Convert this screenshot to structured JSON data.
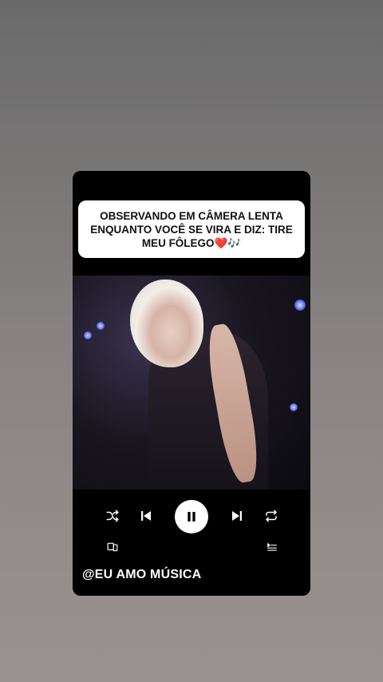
{
  "caption": {
    "text": "OBSERVANDO EM CÂMERA LENTA ENQUANTO VOCÊ SE VIRA E DIZ: TIRE MEU FÔLEGO❤️🎶"
  },
  "player": {
    "controls": {
      "shuffle_icon": "shuffle-icon",
      "previous_icon": "skip-previous-icon",
      "pause_icon": "pause-icon",
      "next_icon": "skip-next-icon",
      "repeat_icon": "repeat-icon"
    },
    "secondary": {
      "devices_icon": "devices-icon",
      "queue_icon": "queue-icon"
    }
  },
  "footer": {
    "handle": "@EU AMO MÚSICA"
  },
  "colors": {
    "card_background": "#000000",
    "caption_background": "#ffffff",
    "control_color": "#ffffff"
  }
}
